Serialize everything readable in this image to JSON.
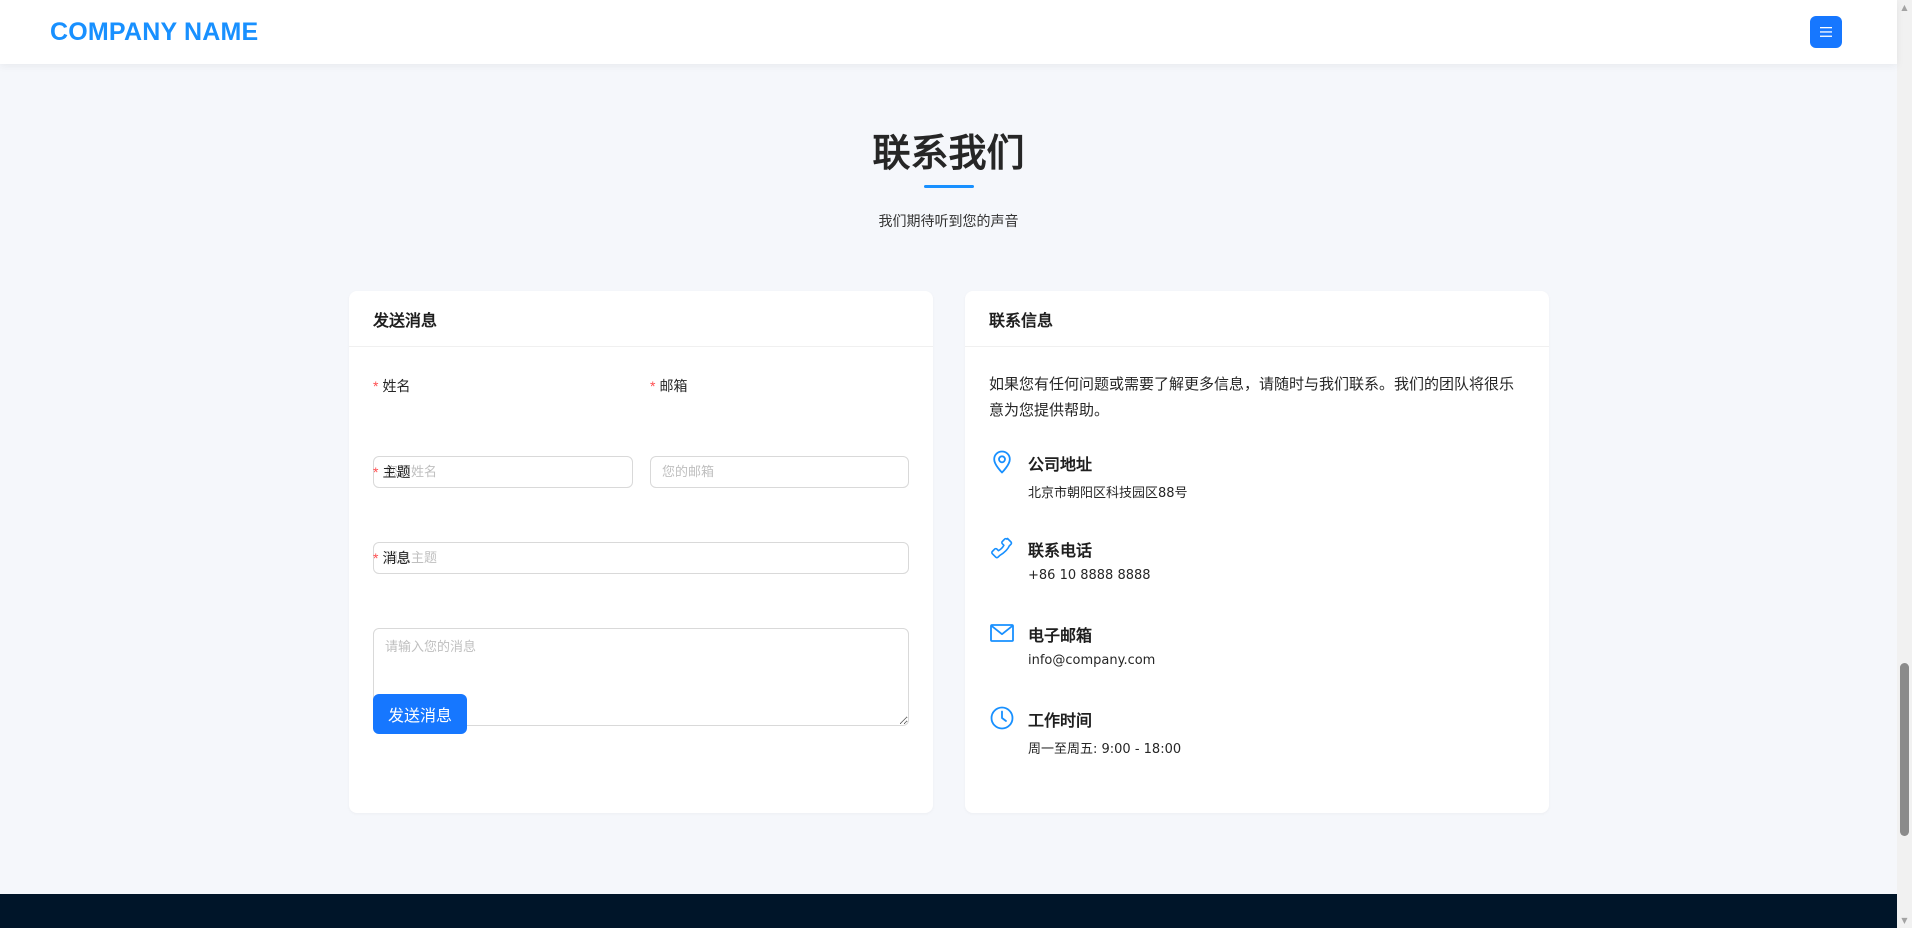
{
  "header": {
    "logo": "COMPANY NAME",
    "menu_icon": "menu-icon"
  },
  "section": {
    "title": "联系我们",
    "subtitle": "我们期待听到您的声音"
  },
  "form_card": {
    "title": "发送消息",
    "required_mark": "*",
    "name_label": "姓名",
    "name_placeholder": "您的姓名",
    "email_label": "邮箱",
    "email_placeholder": "您的邮箱",
    "subject_label": "主题",
    "subject_placeholder": "消息主题",
    "message_label": "消息",
    "message_placeholder": "请输入您的消息",
    "submit_label": "发送消息"
  },
  "info_card": {
    "title": "联系信息",
    "intro": "如果您有任何问题或需要了解更多信息，请随时与我们联系。我们的团队将很乐意为您提供帮助。",
    "items": [
      {
        "icon": "location-icon",
        "title": "公司地址",
        "value": "北京市朝阳区科技园区88号"
      },
      {
        "icon": "phone-icon",
        "title": "联系电话",
        "value": "+86 10 8888 8888"
      },
      {
        "icon": "mail-icon",
        "title": "电子邮箱",
        "value": "info@company.com"
      },
      {
        "icon": "clock-icon",
        "title": "工作时间",
        "value": "周一至周五: 9:00 - 18:00"
      }
    ]
  },
  "colors": {
    "primary": "#1677ff",
    "brand_text": "#1890ff",
    "background": "#f5f7fb",
    "footer": "#001529",
    "required": "#ff4d4f"
  }
}
